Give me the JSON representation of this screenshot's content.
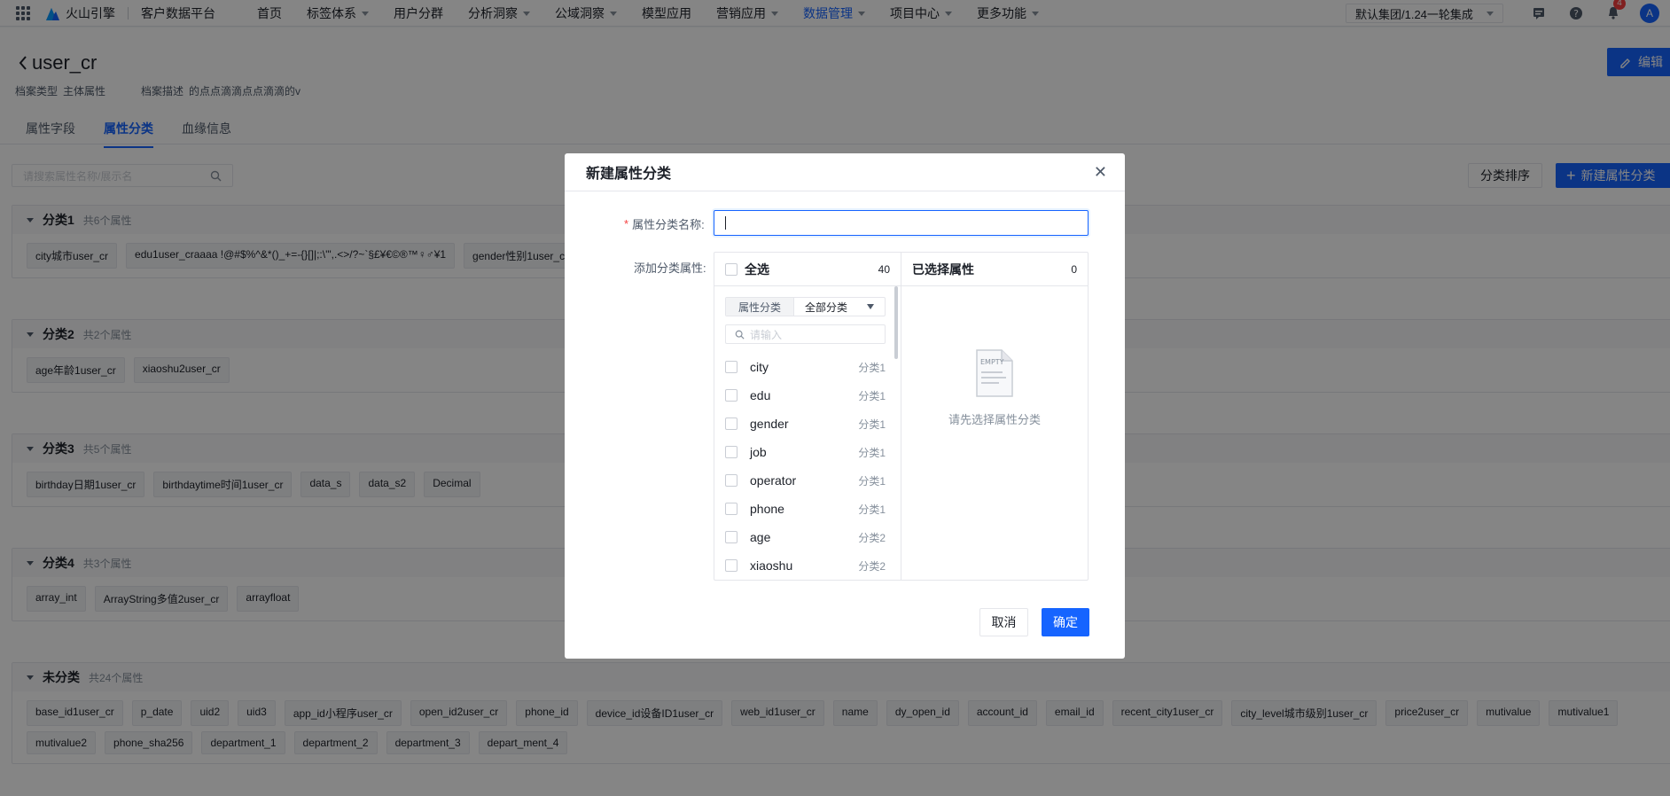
{
  "nav": {
    "brand": "火山引擎",
    "product": "客户数据平台",
    "menu": [
      {
        "label": "首页",
        "dropdown": false,
        "active": false
      },
      {
        "label": "标签体系",
        "dropdown": true,
        "active": false
      },
      {
        "label": "用户分群",
        "dropdown": false,
        "active": false
      },
      {
        "label": "分析洞察",
        "dropdown": true,
        "active": false
      },
      {
        "label": "公域洞察",
        "dropdown": true,
        "active": false
      },
      {
        "label": "模型应用",
        "dropdown": false,
        "active": false
      },
      {
        "label": "营销应用",
        "dropdown": true,
        "active": false
      },
      {
        "label": "数据管理",
        "dropdown": true,
        "active": true
      },
      {
        "label": "项目中心",
        "dropdown": true,
        "active": false
      },
      {
        "label": "更多功能",
        "dropdown": true,
        "active": false
      }
    ],
    "tenant": "默认集团/1.24一轮集成",
    "notification_count": "4",
    "avatar_letter": "A"
  },
  "page": {
    "title": "user_cr",
    "edit_label": "编辑",
    "meta_type_label": "档案类型",
    "meta_type_value": "主体属性",
    "meta_desc_label": "档案描述",
    "meta_desc_value": "的点点滴滴点点滴滴的v",
    "tabs": [
      {
        "label": "属性字段",
        "active": false
      },
      {
        "label": "属性分类",
        "active": true
      },
      {
        "label": "血缘信息",
        "active": false
      }
    ],
    "search_placeholder": "请搜索属性名称/展示名",
    "sort_label": "分类排序",
    "new_label": "新建属性分类"
  },
  "groups": [
    {
      "title": "分类1",
      "count": "共6个属性",
      "tags": [
        "city城市user_cr",
        "edu1user_craaaa !@#$%^&*()_+=-{}[]|;:\\'\",.<>/?~`§£¥€©®™♀♂¥1",
        "gender性别1user_cr"
      ]
    },
    {
      "title": "分类2",
      "count": "共2个属性",
      "tags": [
        "age年龄1user_cr",
        "xiaoshu2user_cr"
      ]
    },
    {
      "title": "分类3",
      "count": "共5个属性",
      "tags": [
        "birthday日期1user_cr",
        "birthdaytime时间1user_cr",
        "data_s",
        "data_s2",
        "Decimal"
      ]
    },
    {
      "title": "分类4",
      "count": "共3个属性",
      "tags": [
        "array_int",
        "ArrayString多值2user_cr",
        "arrayfloat"
      ]
    },
    {
      "title": "未分类",
      "count": "共24个属性",
      "tags": [
        "base_id1user_cr",
        "p_date",
        "uid2",
        "uid3",
        "app_id小程序user_cr",
        "open_id2user_cr",
        "phone_id",
        "device_id设备ID1user_cr",
        "web_id1user_cr",
        "name",
        "dy_open_id",
        "account_id",
        "email_id",
        "recent_city1user_cr",
        "city_level城市级别1user_cr",
        "price2user_cr",
        "mutivalue",
        "mutivalue1",
        "mutivalue2",
        "phone_sha256",
        "department_1",
        "department_2",
        "department_3",
        "depart_ment_4"
      ]
    }
  ],
  "modal": {
    "title": "新建属性分类",
    "name_label": "属性分类名称:",
    "add_label": "添加分类属性:",
    "select_all": "全选",
    "total": "40",
    "filter_label": "属性分类",
    "filter_value": "全部分类",
    "search_placeholder": "请输入",
    "items": [
      {
        "name": "city",
        "group": "分类1"
      },
      {
        "name": "edu",
        "group": "分类1"
      },
      {
        "name": "gender",
        "group": "分类1"
      },
      {
        "name": "job",
        "group": "分类1"
      },
      {
        "name": "operator",
        "group": "分类1"
      },
      {
        "name": "phone",
        "group": "分类1"
      },
      {
        "name": "age",
        "group": "分类2"
      },
      {
        "name": "xiaoshu",
        "group": "分类2"
      }
    ],
    "selected_title": "已选择属性",
    "selected_count": "0",
    "empty_icon_text": "EMPTY",
    "empty_text": "请先选择属性分类",
    "cancel": "取消",
    "ok": "确定"
  },
  "colors": {
    "primary": "#1664ff",
    "danger": "#f53f3f"
  }
}
